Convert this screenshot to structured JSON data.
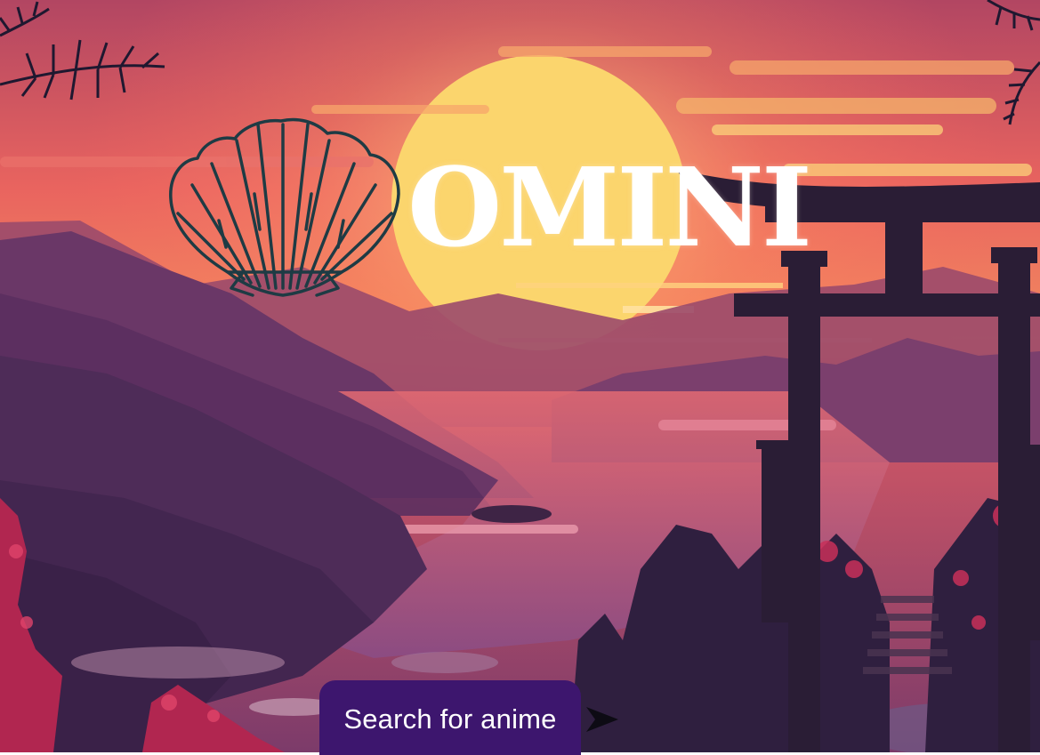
{
  "brand": {
    "name": "OMINI",
    "logo_icon": "scallop-shell-icon"
  },
  "search": {
    "label": "Search for anime",
    "arrow_icon": "arrow-right-icon"
  },
  "scene": {
    "description_icon": "sunset-torii-landscape",
    "colors": {
      "sky_top": "#b8405c",
      "sky_glow": "#f46a5a",
      "sun": "#fbd36c",
      "mountain_far": "#7a3a66",
      "mountain_near": "#3c2450",
      "torii": "#2a1d35",
      "foliage": "#c32a54"
    }
  },
  "colors": {
    "search_bg": "#3d166e",
    "logo_stroke": "#1e3b44",
    "brand_text": "#ffffff"
  }
}
